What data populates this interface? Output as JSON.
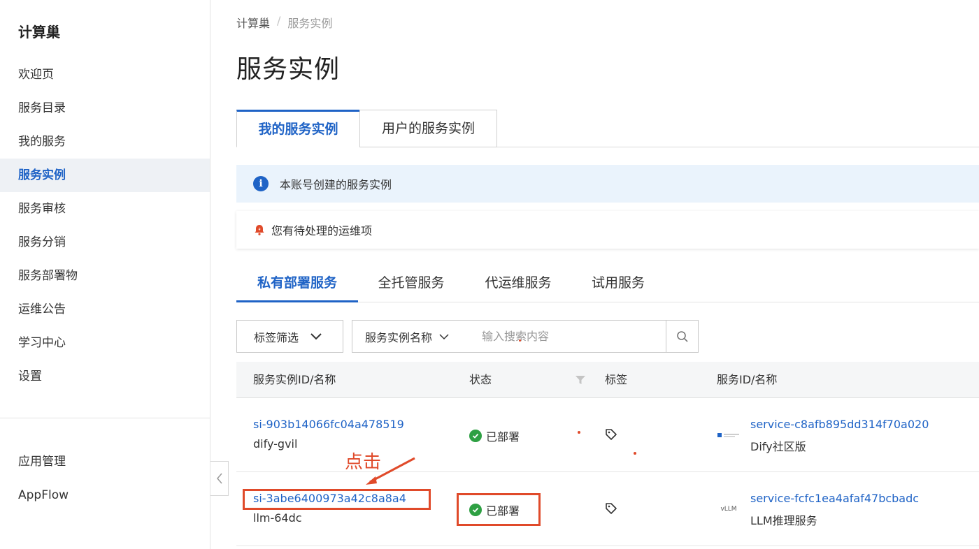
{
  "sidebar": {
    "title": "计算巢",
    "items": [
      {
        "label": "欢迎页"
      },
      {
        "label": "服务目录"
      },
      {
        "label": "我的服务"
      },
      {
        "label": "服务实例"
      },
      {
        "label": "服务审核"
      },
      {
        "label": "服务分销"
      },
      {
        "label": "服务部署物"
      },
      {
        "label": "运维公告"
      },
      {
        "label": "学习中心"
      },
      {
        "label": "设置"
      }
    ],
    "active_index": 3,
    "bottom_items": [
      {
        "label": "应用管理"
      },
      {
        "label": "AppFlow"
      }
    ]
  },
  "breadcrumb": {
    "root": "计算巢",
    "separator": "/",
    "current": "服务实例"
  },
  "page": {
    "title": "服务实例"
  },
  "top_tabs": [
    {
      "label": "我的服务实例"
    },
    {
      "label": "用户的服务实例"
    }
  ],
  "info_message": "本账号创建的服务实例",
  "warn_message": "您有待处理的运维项",
  "sub_tabs": [
    {
      "label": "私有部署服务"
    },
    {
      "label": "全托管服务"
    },
    {
      "label": "代运维服务"
    },
    {
      "label": "试用服务"
    }
  ],
  "filters": {
    "tag_filter_label": "标签筛选",
    "search_field_label": "服务实例名称",
    "search_placeholder": "输入搜索内容"
  },
  "table": {
    "columns": [
      "服务实例ID/名称",
      "状态",
      "标签",
      "服务ID/名称"
    ],
    "rows": [
      {
        "instance_id": "si-903b14066fc04a478519",
        "instance_name": "dify-gvil",
        "status": "已部署",
        "service_id": "service-c8afb895dd314f70a020",
        "service_name": "Dify社区版",
        "logo": "dify"
      },
      {
        "instance_id": "si-3abe6400973a42c8a8a4",
        "instance_name": "llm-64dc",
        "status": "已部署",
        "service_id": "service-fcfc1ea4afaf47bcbadc",
        "service_name": "LLM推理服务",
        "logo": "vLLM"
      }
    ]
  },
  "annotation": {
    "text": "点击",
    "color": "#e04a2a"
  },
  "colors": {
    "primary": "#1f63c6",
    "success": "#2ea043",
    "annotation": "#e04a2a"
  }
}
